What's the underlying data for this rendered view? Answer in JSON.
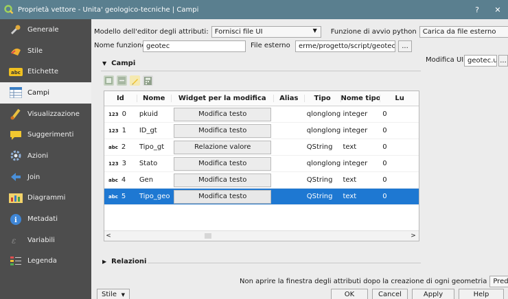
{
  "window": {
    "title": "Proprietà vettore - Unita' geologico-tecniche | Campi",
    "help_btn": "?",
    "close_btn": "✕"
  },
  "sidebar": {
    "items": [
      {
        "label": "Generale",
        "icon": "wrench-icon"
      },
      {
        "label": "Stile",
        "icon": "paint-icon"
      },
      {
        "label": "Etichette",
        "icon": "label-abc-icon"
      },
      {
        "label": "Campi",
        "icon": "fields-table-icon"
      },
      {
        "label": "Visualizzazione",
        "icon": "brush-icon"
      },
      {
        "label": "Suggerimenti",
        "icon": "tooltip-icon"
      },
      {
        "label": "Azioni",
        "icon": "actions-gear-icon"
      },
      {
        "label": "Join",
        "icon": "join-arrow-icon"
      },
      {
        "label": "Diagrammi",
        "icon": "diagram-icon"
      },
      {
        "label": "Metadati",
        "icon": "info-icon"
      },
      {
        "label": "Variabili",
        "icon": "variables-icon"
      },
      {
        "label": "Legenda",
        "icon": "legend-icon"
      }
    ],
    "active_index": 3
  },
  "editor": {
    "modello_label": "Modello dell'editor degli attributi:",
    "modello_value": "Fornisci file UI",
    "funzione_avvio_label": "Funzione di avvio python",
    "funzione_avvio_value": "Carica da file esterno",
    "nome_funzione_label": "Nome funzione",
    "nome_funzione_value": "geotec",
    "file_esterno_label": "File esterno",
    "file_esterno_value": "erme/progetto/script/geotec.py",
    "browse_label": "...",
    "modifica_ui_label": "Modifica UI",
    "modifica_ui_value": "geotec.ui",
    "browse_ui_label": "..."
  },
  "campi": {
    "title": "Campi",
    "headers": [
      "Id",
      "Nome",
      "Widget per la modifica",
      "Alias",
      "Tipo",
      "Nome tipo",
      "Lu"
    ],
    "rows": [
      {
        "tag": "123",
        "id": "0",
        "nome": "pkuid",
        "widget": "Modifica testo",
        "alias": "",
        "tipo": "qlonglong",
        "nome_tipo": "integer",
        "lu": "0"
      },
      {
        "tag": "123",
        "id": "1",
        "nome": "ID_gt",
        "widget": "Modifica testo",
        "alias": "",
        "tipo": "qlonglong",
        "nome_tipo": "integer",
        "lu": "0"
      },
      {
        "tag": "abc",
        "id": "2",
        "nome": "Tipo_gt",
        "widget": "Relazione valore",
        "alias": "",
        "tipo": "QString",
        "nome_tipo": "text",
        "lu": "0"
      },
      {
        "tag": "123",
        "id": "3",
        "nome": "Stato",
        "widget": "Modifica testo",
        "alias": "",
        "tipo": "qlonglong",
        "nome_tipo": "integer",
        "lu": "0"
      },
      {
        "tag": "abc",
        "id": "4",
        "nome": "Gen",
        "widget": "Modifica testo",
        "alias": "",
        "tipo": "QString",
        "nome_tipo": "text",
        "lu": "0"
      },
      {
        "tag": "abc",
        "id": "5",
        "nome": "Tipo_geo",
        "widget": "Modifica testo",
        "alias": "",
        "tipo": "QString",
        "nome_tipo": "text",
        "lu": "0"
      }
    ],
    "selected_row": 5,
    "scroll_left": "<",
    "scroll_right": ">"
  },
  "relazioni": {
    "title": "Relazioni"
  },
  "options": {
    "checkbox_label": "Non aprire la finestra degli attributi dopo la creazione di ogni geometria",
    "checkbox_value": "Predefinito"
  },
  "footer": {
    "stile": "Stile",
    "ok": "OK",
    "cancel": "Cancel",
    "apply": "Apply",
    "help": "Help"
  },
  "colors": {
    "titlebar": "#5a7f8f",
    "sidebar": "#4d4d4d",
    "selection": "#1e78d2"
  }
}
